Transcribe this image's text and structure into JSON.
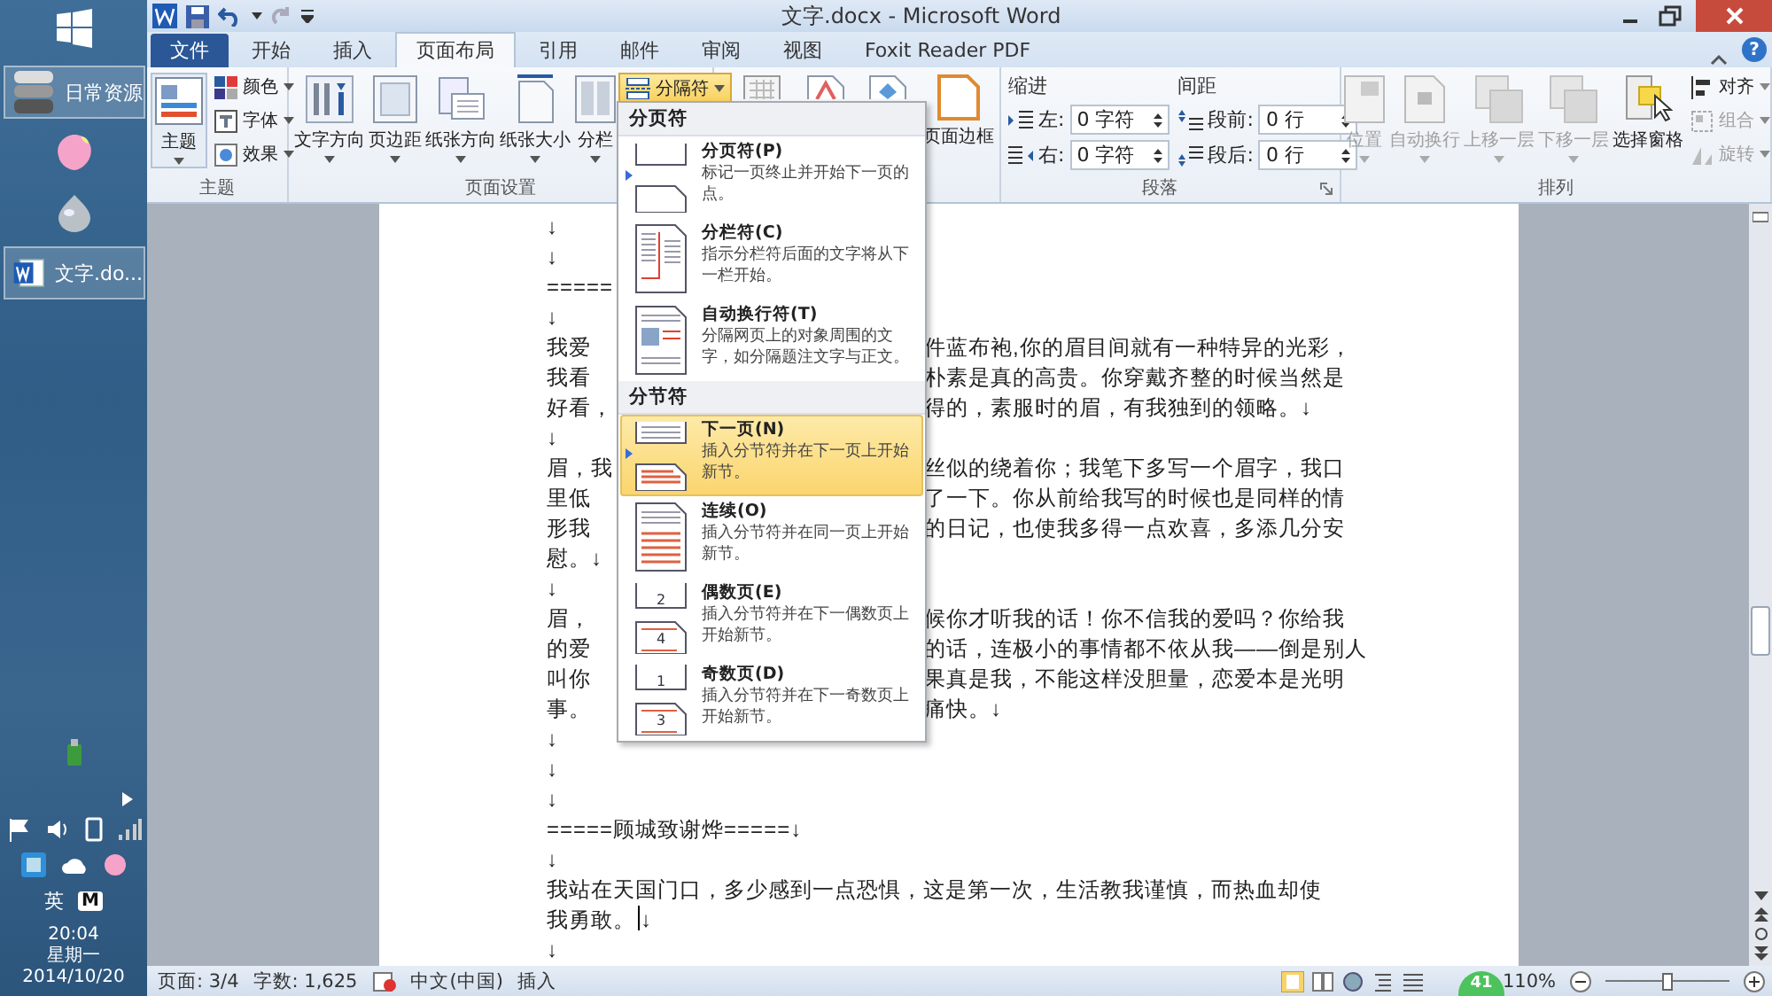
{
  "taskbar": {
    "items": [
      {
        "kind": "library",
        "label": "日常资源"
      },
      {
        "kind": "peach"
      },
      {
        "kind": "pearl"
      },
      {
        "kind": "word",
        "label": "文字.do..."
      }
    ],
    "ime": "英",
    "ime_mode": "M",
    "time": "20:04",
    "weekday": "星期一",
    "date": "2014/10/20"
  },
  "window": {
    "title": "文字.docx - Microsoft Word",
    "help": "?"
  },
  "tabs": [
    {
      "label": "文件",
      "kind": "file",
      "selected": false
    },
    {
      "label": "开始",
      "kind": "tab",
      "selected": false
    },
    {
      "label": "插入",
      "kind": "tab",
      "selected": false
    },
    {
      "label": "页面布局",
      "kind": "tab",
      "selected": true
    },
    {
      "label": "引用",
      "kind": "tab",
      "selected": false
    },
    {
      "label": "邮件",
      "kind": "tab",
      "selected": false
    },
    {
      "label": "审阅",
      "kind": "tab",
      "selected": false
    },
    {
      "label": "视图",
      "kind": "tab",
      "selected": false
    },
    {
      "label": "Foxit Reader PDF",
      "kind": "tab",
      "selected": false
    }
  ],
  "ribbon": {
    "theme": {
      "label": "主题",
      "main": "主题",
      "small": [
        {
          "label": "颜色",
          "kind": "colors"
        },
        {
          "label": "字体",
          "kind": "fonts"
        },
        {
          "label": "效果",
          "kind": "effects"
        }
      ]
    },
    "page_setup": {
      "label": "页面设置",
      "large": [
        {
          "label": "文字方向",
          "kind": "text-direction"
        },
        {
          "label": "页边距",
          "kind": "margins"
        },
        {
          "label": "纸张方向",
          "kind": "orientation"
        },
        {
          "label": "纸张大小",
          "kind": "size"
        },
        {
          "label": "分栏",
          "kind": "columns"
        }
      ],
      "breaks": {
        "label": "分隔符",
        "open": true
      }
    },
    "page_background": {
      "buttons": [
        {
          "kind": "manuscript"
        },
        {
          "kind": "watermark"
        },
        {
          "kind": "page-color"
        },
        {
          "kind": "page-border",
          "label": "页面边框"
        }
      ]
    },
    "paragraph": {
      "label": "段落",
      "indent": {
        "label": "缩进",
        "fields": [
          {
            "kind": "left",
            "label": "左:",
            "value": "0 字符"
          },
          {
            "kind": "right",
            "label": "右:",
            "value": "0 字符"
          }
        ]
      },
      "spacing": {
        "label": "间距",
        "fields": [
          {
            "kind": "before",
            "label": "段前:",
            "value": "0 行"
          },
          {
            "kind": "after",
            "label": "段后:",
            "value": "0 行"
          }
        ]
      }
    },
    "arrange": {
      "label": "排列",
      "large": [
        {
          "label": "位置",
          "kind": "position",
          "disabled": true,
          "caret": true
        },
        {
          "label": "自动换行",
          "kind": "wrap",
          "disabled": true,
          "caret": true
        },
        {
          "label": "上移一层",
          "kind": "forward",
          "disabled": true,
          "caret": true
        },
        {
          "label": "下移一层",
          "kind": "backward",
          "disabled": true,
          "caret": true
        },
        {
          "label": "选择窗格",
          "kind": "selection",
          "disabled": false,
          "caret": false
        }
      ],
      "small": [
        {
          "label": "对齐",
          "kind": "align",
          "disabled": false
        },
        {
          "label": "组合",
          "kind": "group",
          "disabled": true
        },
        {
          "label": "旋转",
          "kind": "rotate",
          "disabled": true
        }
      ]
    }
  },
  "breaks_menu": {
    "sections": [
      {
        "header": "分页符",
        "items": [
          {
            "kind": "page-break",
            "title": "分页符(P)",
            "description": "标记一页终止并开始下一页的点。",
            "selected": false
          },
          {
            "kind": "column-break",
            "title": "分栏符(C)",
            "description": "指示分栏符后面的文字将从下一栏开始。",
            "selected": false
          },
          {
            "kind": "text-wrapping",
            "title": "自动换行符(T)",
            "description": "分隔网页上的对象周围的文字，如分隔题注文字与正文。",
            "selected": false
          }
        ]
      },
      {
        "header": "分节符",
        "items": [
          {
            "kind": "next-page",
            "title": "下一页(N)",
            "description": "插入分节符并在下一页上开始新节。",
            "selected": true
          },
          {
            "kind": "continuous",
            "title": "连续(O)",
            "description": "插入分节符并在同一页上开始新节。",
            "selected": false
          },
          {
            "kind": "even-page",
            "title": "偶数页(E)",
            "description": "插入分节符并在下一偶数页上开始新节。",
            "selected": false,
            "page_numbers": [
              "2",
              "4"
            ]
          },
          {
            "kind": "odd-page",
            "title": "奇数页(D)",
            "description": "插入分节符并在下一奇数页上开始新节。",
            "selected": false,
            "page_numbers": [
              "1",
              "3"
            ]
          }
        ]
      }
    ]
  },
  "document": {
    "lines": [
      {
        "left": "↓"
      },
      {
        "left": "↓"
      },
      {
        "left": "====="
      },
      {
        "left": "↓"
      },
      {
        "left": "我爱",
        "right": "件蓝布袍,你的眉目间就有一种特异的光彩，"
      },
      {
        "left": "我看",
        "right": "朴素是真的高贵。你穿戴齐整的时候当然是"
      },
      {
        "left": "好看，",
        "right": "得的，素服时的眉，有我独到的领略。↓"
      },
      {
        "left": "↓"
      },
      {
        "left": "眉，我",
        "right": "丝似的绕着你；我笔下多写一个眉字，我口"
      },
      {
        "left": "里低",
        "right": "了一下。你从前给我写的时候也是同样的情"
      },
      {
        "left": "形我",
        "right": "的日记，也使我多得一点欢喜，多添几分安"
      },
      {
        "left": "慰。↓"
      },
      {
        "left": "↓"
      },
      {
        "left": "眉，",
        "right": "候你才听我的话！你不信我的爱吗？你给我"
      },
      {
        "left": "的爱",
        "right": "的话，连极小的事情都不依从我——倒是别人"
      },
      {
        "left": "叫你",
        "right": "果真是我，不能这样没胆量，恋爱本是光明"
      },
      {
        "left": "事。",
        "right": "痛快。↓"
      },
      {
        "left": "↓"
      },
      {
        "left": "↓"
      },
      {
        "left": "↓"
      },
      {
        "left": "=====顾城致谢烨=====↓"
      },
      {
        "left": "↓"
      },
      {
        "left": "我站在天国门口，多少感到一点恐惧，这是第一次，生活教我谨慎，而热血却使"
      },
      {
        "left": "我勇敢。",
        "cursor": true,
        "mark": "↓"
      },
      {
        "left": "↓"
      }
    ]
  },
  "status_bar": {
    "page": "页面: 3/4",
    "words": "字数: 1,625",
    "language": "中文(中国)",
    "mode": "插入",
    "zoom": "110%",
    "zoom_slider": {
      "level": 0.5
    }
  },
  "floating_badge": "41"
}
